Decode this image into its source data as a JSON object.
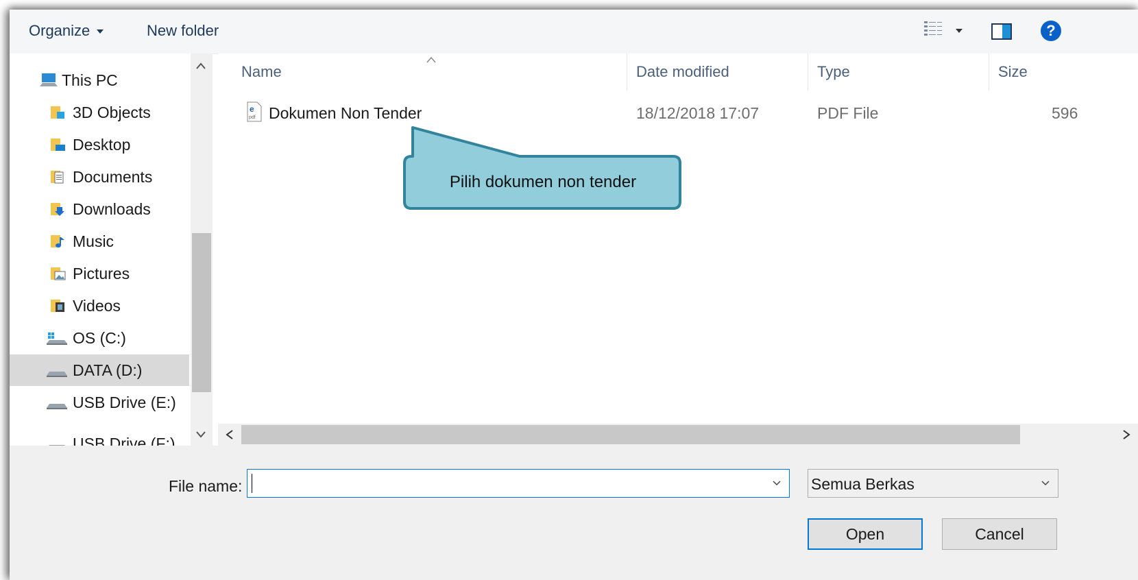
{
  "toolbar": {
    "organize_label": "Organize",
    "new_folder_label": "New folder",
    "help_label": "?"
  },
  "nav": {
    "items": [
      {
        "label": "This PC",
        "icon": "computer-icon"
      },
      {
        "label": "3D Objects",
        "icon": "3d-objects-folder-icon"
      },
      {
        "label": "Desktop",
        "icon": "desktop-folder-icon"
      },
      {
        "label": "Documents",
        "icon": "documents-folder-icon"
      },
      {
        "label": "Downloads",
        "icon": "downloads-folder-icon"
      },
      {
        "label": "Music",
        "icon": "music-folder-icon"
      },
      {
        "label": "Pictures",
        "icon": "pictures-folder-icon"
      },
      {
        "label": "Videos",
        "icon": "videos-folder-icon"
      },
      {
        "label": "OS (C:)",
        "icon": "windows-drive-icon"
      },
      {
        "label": "DATA (D:)",
        "icon": "drive-icon"
      },
      {
        "label": "USB Drive (E:)",
        "icon": "drive-icon"
      },
      {
        "label": "USB Drive (F:)",
        "icon": "drive-icon"
      }
    ],
    "selected": "DATA (D:)"
  },
  "columns": {
    "name": "Name",
    "date": "Date modified",
    "type": "Type",
    "size": "Size"
  },
  "files": [
    {
      "name": "Dokumen Non Tender",
      "date": "18/12/2018 17:07",
      "type": "PDF File",
      "size": "596"
    }
  ],
  "bottom": {
    "file_name_label": "File name:",
    "file_name_value": "",
    "file_type_value": "Semua Berkas",
    "open_label": "Open",
    "cancel_label": "Cancel"
  },
  "callout": {
    "text": "Pilih dokumen non tender",
    "fill": "#92cddc",
    "stroke": "#31849b"
  },
  "colors": {
    "accent": "#0078d7",
    "selection": "#d9d9d9",
    "help": "#0a62c9"
  }
}
